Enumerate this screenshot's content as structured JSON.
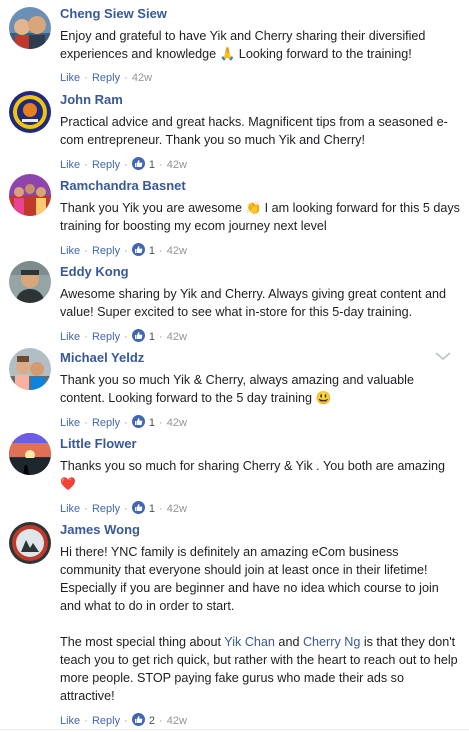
{
  "actions": {
    "like": "Like",
    "reply": "Reply"
  },
  "colors": {
    "author": "#385898",
    "link": "#4267b2",
    "meta": "#90949c",
    "like_badge": "#4267b2"
  },
  "comments": [
    {
      "author": "Cheng Siew Siew",
      "text": "Enjoy and grateful to have Yik and Cherry sharing their diversified experiences and knowledge 🙏 Looking forward to the training!",
      "likes": "",
      "time": "42w",
      "avatar_icon": "family-photo-avatar"
    },
    {
      "author": "John Ram",
      "text": "Practical advice and great hacks. Magnificent tips from a seasoned e-com entrepreneur. Thank you so much Yik and Cherry!",
      "likes": "1",
      "time": "42w",
      "avatar_icon": "emblem-avatar"
    },
    {
      "author": "Ramchandra Basnet",
      "text": "Thank you Yik you are awesome 👏 I am looking forward for this 5 days training for boosting my ecom journey next level",
      "likes": "1",
      "time": "42w",
      "avatar_icon": "group-photo-avatar"
    },
    {
      "author": "Eddy Kong",
      "text": "Awesome sharing by Yik and Cherry. Always giving great content and value! Super excited to see what in-store for this 5-day training.",
      "likes": "1",
      "time": "42w",
      "avatar_icon": "portrait-avatar"
    },
    {
      "author": "Michael Yeldz",
      "text": "Thank you so much Yik & Cherry, always amazing and valuable content. Looking forward to the 5 day training 😃",
      "likes": "1",
      "time": "42w",
      "avatar_icon": "couple-photo-avatar"
    },
    {
      "author": "Little Flower",
      "text": "Thanks you so much for sharing Cherry & Yik . You both are amazing ❤️",
      "likes": "1",
      "time": "42w",
      "avatar_icon": "sunset-avatar"
    },
    {
      "author": "James Wong",
      "paragraph1": "Hi there! YNC family is definitely an amazing eCom business community that everyone should join at least once in their lifetime! Especially if you are beginner and have no idea which course to join and what to do in order to start.",
      "p2_before": "The most special thing about ",
      "mention1": "Yik Chan",
      "p2_and": " and ",
      "mention2": "Cherry Ng",
      "p2_after": " is that they don't teach you to get rich quick, but rather with the heart to reach out to help more people. STOP paying fake gurus who made their ads so attractive!",
      "likes": "2",
      "time": "42w",
      "avatar_icon": "logo-avatar"
    }
  ]
}
